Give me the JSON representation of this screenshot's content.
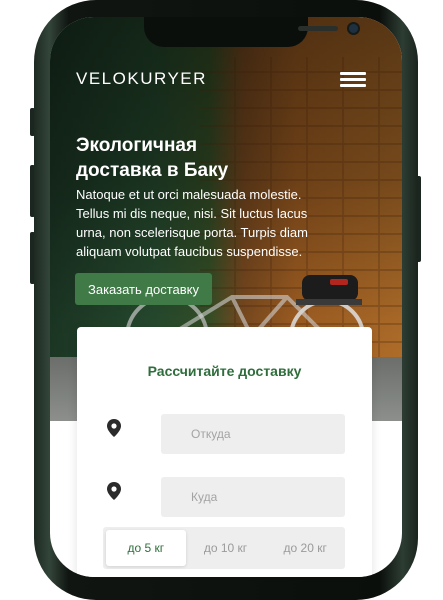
{
  "header": {
    "brand": "VELOKURYER",
    "menu_icon": "hamburger-menu-icon"
  },
  "hero": {
    "title_line1": "Экологичная",
    "title_line2": "доставка в Баку",
    "text": "Natoque et ut orci malesuada molestie. Tellus mi dis neque, nisi. Sit luctus lacus urna, non scelerisque porta. Turpis diam aliquam volutpat faucibus suspendisse.",
    "cta_label": "Заказать доставку"
  },
  "calculator": {
    "title": "Рассчитайте доставку",
    "from_placeholder": "Откуда",
    "to_placeholder": "Куда",
    "pin_icon": "location-pin-icon",
    "weights": [
      {
        "label": "до 5 кг",
        "selected": true
      },
      {
        "label": "до 10 кг",
        "selected": false
      },
      {
        "label": "до 20 кг",
        "selected": false
      }
    ]
  },
  "colors": {
    "accent": "#3f7a47",
    "accent_text": "#2f6e3c",
    "field_bg": "#eeeeee"
  }
}
